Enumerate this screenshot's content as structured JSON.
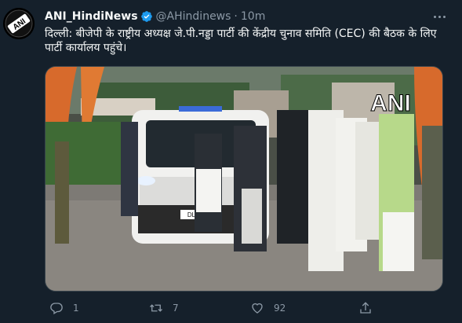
{
  "tweet": {
    "author_name": "ANI_HindiNews",
    "handle": "@AHindinews",
    "separator": "·",
    "time": "10m",
    "text": "दिल्ली: बीजेपी के राष्ट्रीय अध्यक्ष जे.पी.नड्डा पार्टी की केंद्रीय चुनाव समिति (CEC) की बैठक के लिए पार्टी कार्यालय पहुंचे।",
    "media_watermark": "ANI",
    "avatar_logo": "ANI",
    "vehicle_plate": "DL"
  },
  "actions": {
    "reply_count": "1",
    "retweet_count": "7",
    "like_count": "92",
    "share_count": ""
  },
  "icons": [
    "verified-badge-icon",
    "more-icon",
    "reply-icon",
    "retweet-icon",
    "like-icon",
    "share-icon"
  ],
  "colors": {
    "background": "#15202b",
    "text_primary": "#f7f9f9",
    "text_secondary": "#8b98a5",
    "verified": "#1d9bf0",
    "border": "#38444d"
  }
}
